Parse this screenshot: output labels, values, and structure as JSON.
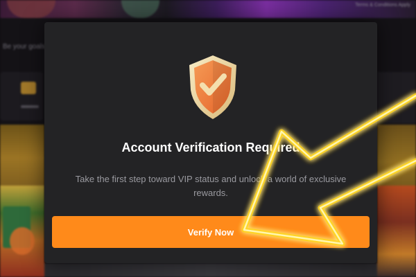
{
  "background": {
    "terms_text": "Terms & Conditions Apply",
    "caption_text": "Be your goals to"
  },
  "modal": {
    "icon": "shield-check-icon",
    "title": "Account Verification Required",
    "description": "Take the first step toward VIP status and unlock a world of exclusive rewards.",
    "button_label": "Verify Now"
  },
  "colors": {
    "accent": "#ff8a1a",
    "modal_bg": "#232325",
    "title": "#ffffff",
    "description": "#9a9aa0",
    "shield": "#f07f3a",
    "shield_rim": "#f3e3b6",
    "arrow_glow": "#ffd400"
  },
  "overlay": {
    "arrow_icon": "pointer-arrow-icon"
  }
}
